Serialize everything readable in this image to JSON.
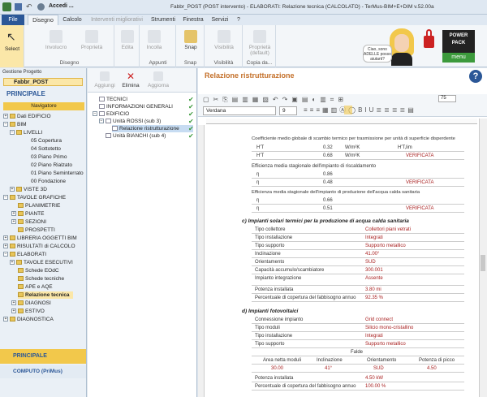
{
  "window": {
    "title": "Fabbr_POST (POST intervento) - ELABORATI: Relazione tecnica (CALCOLATO) - TerMus-BIM+E+DIM v.52.00a",
    "quick": "Accedi ..."
  },
  "tabs": [
    "File",
    "Disegno",
    "Calcolo",
    "Interventi migliorativi",
    "Strumenti",
    "Finestra",
    "Servizi",
    "?"
  ],
  "ribbon": {
    "select": "Select",
    "involucro": "Involucro",
    "proprieta": "Proprietà",
    "edita": "Edita",
    "incolla": "Incolla",
    "snap": "Snap",
    "visibilita": "Visibilità",
    "proprieta_default": "Proprietà (default)",
    "group_disegno": "Disegno",
    "group_appunti": "Appunti",
    "group_snap": "Snap",
    "group_visibilita": "Visibilità",
    "group_copia": "Copia da...",
    "bubble": "Ciao, sono ADELLE posso aiutarti?",
    "powerpack": "POWER PACK",
    "menu": "menu"
  },
  "left": {
    "header": "Gestione Progetto",
    "project": "Fabbr_POST",
    "principale": "PRINCIPALE",
    "navigatore": "Navigatore",
    "items": [
      "Dati EDIFICIO",
      "BIM",
      "LIVELLI",
      "05 Copertura",
      "04 Sottotetto",
      "03 Piano Primo",
      "02 Piano Rialzato",
      "01 Piano Seminterrato",
      "00 Fondazione",
      "VISTE 3D",
      "TAVOLE GRAFICHE",
      "PLANIMETRIE",
      "PIANTE",
      "SEZIONI",
      "PROSPETTI",
      "LIBRERIA OGGETTI BIM",
      "RISULTATI di CALCOLO",
      "ELABORATI",
      "TAVOLE ESECUTIVI",
      "Schede EOdC",
      "Schede tecniche",
      "APE e AQE",
      "Relazione tecnica",
      "DIAGNOSI",
      "ESTIVO",
      "DIAGNOSTICA"
    ],
    "bottom1": "PRINCIPALE",
    "bottom2": "COMPUTO (PriMus)"
  },
  "mid": {
    "aggiungi": "Aggiungi",
    "elimina": "Elimina",
    "aggiorna": "Aggiorna",
    "items": [
      "TECNICI",
      "INFORMAZIONI GENERALI",
      "EDIFICIO",
      "Unità ROSSI (sub 3)",
      "Relazione ristrutturazione",
      "Unità BIANCHI (sub 4)"
    ]
  },
  "main": {
    "title": "Relazione ristrutturazione",
    "font": "Verdana",
    "size": "9",
    "zoom": "75"
  },
  "doc": {
    "l1": "Coefficiente medio globale di scambio termico per trasmissione per unità di superficie disperdente",
    "h1a": "H'T",
    "h1av": "0.32",
    "h1au": "W/m²K",
    "h1ar": "H'T,lim",
    "h1b": "H'T",
    "h1bv": "0.68",
    "h1bu": "W/m²K",
    "h1br": "VERIFICATA",
    "l2": "Efficienza media stagionale dell'impianto di riscaldamento",
    "e1v": "0.86",
    "e2v": "0.48",
    "e2r": "VERIFICATA",
    "l3": "Efficienza media stagionale dell'impianto di produzione dell'acqua calda sanitaria",
    "e3v": "0.66",
    "e4v": "0.51",
    "e4r": "VERIFICATA",
    "c_title": "c) Impianti solari termici per la produzione di acqua calda sanitaria",
    "c_rows": [
      [
        "Tipo collettore",
        "Collettori piani vetrati"
      ],
      [
        "Tipo installazione",
        "Integrati"
      ],
      [
        "Tipo supporto",
        "Supporto metallico"
      ],
      [
        "Inclinazione",
        "41.00°"
      ],
      [
        "Orientamento",
        "SUD"
      ],
      [
        "Capacità accumulo/scambiatore",
        "300.001"
      ],
      [
        "Impianto integrazione",
        "Assente"
      ],
      [
        "Potenza installata",
        "3.80 mi"
      ],
      [
        "Percentuale di copertura del fabbisogno annuo",
        "92.35 %"
      ]
    ],
    "d_title": "d) Impianti fotovoltaici",
    "d_rows": [
      [
        "Connessione impianto",
        "Grid connect"
      ],
      [
        "Tipo moduli",
        "Silicio mono-cristallino"
      ],
      [
        "Tipo installazione",
        "Integrati"
      ],
      [
        "Tipo supporto",
        "Supporto metallico"
      ]
    ],
    "falde": "Falde",
    "falde_h": [
      "Area netta moduli",
      "Inclinazione",
      "Orientamento",
      "Potenza di picco"
    ],
    "falde_v": [
      "30.00",
      "41°",
      "SUD",
      "4.50"
    ],
    "d_rows2": [
      [
        "Potenza installata",
        "4.50 kW"
      ],
      [
        "Percentuale di copertura del fabbisogno annuo",
        "100.00 %"
      ]
    ]
  }
}
